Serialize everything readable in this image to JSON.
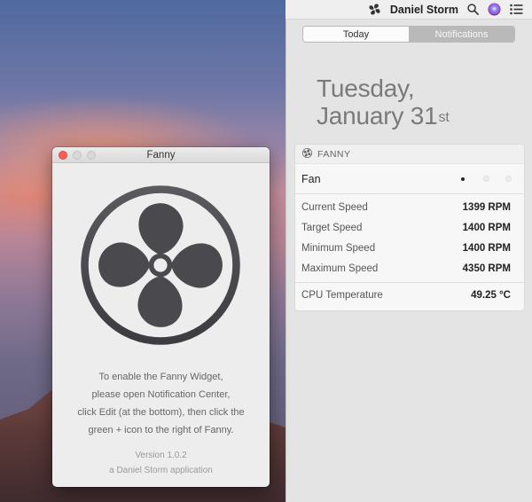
{
  "menubar": {
    "user_name": "Daniel Storm",
    "icons": [
      "fan-icon",
      "search-icon",
      "siri-icon",
      "notification-center-icon"
    ]
  },
  "notification_center": {
    "tabs": [
      {
        "label": "Today",
        "active": true
      },
      {
        "label": "Notifications",
        "active": false
      }
    ],
    "date": {
      "weekday": "Tuesday,",
      "month_day": "January 31",
      "suffix": "st"
    },
    "widget": {
      "header": "FANNY",
      "fan_label": "Fan",
      "fan_pages": 3,
      "fan_current_page": 1,
      "stats": [
        {
          "label": "Current Speed",
          "value": "1399 RPM"
        },
        {
          "label": "Target Speed",
          "value": "1400 RPM"
        },
        {
          "label": "Minimum Speed",
          "value": "1400 RPM"
        },
        {
          "label": "Maximum Speed",
          "value": "4350 RPM"
        }
      ],
      "temperature": {
        "label": "CPU Temperature",
        "value": "49.25 °C"
      }
    }
  },
  "app_window": {
    "title": "Fanny",
    "logo_icon": "fan-icon",
    "instructions": [
      "To enable the Fanny Widget,",
      "please open Notification Center,",
      "click Edit (at the bottom), then click the",
      "green + icon to the right of Fanny."
    ],
    "version": "Version 1.0.2",
    "credit": "a Daniel Storm application"
  },
  "colors": {
    "close_button": "#fc5f57",
    "fan_logo": "#4a4a4e",
    "accent_text": "#7a7a7a"
  }
}
